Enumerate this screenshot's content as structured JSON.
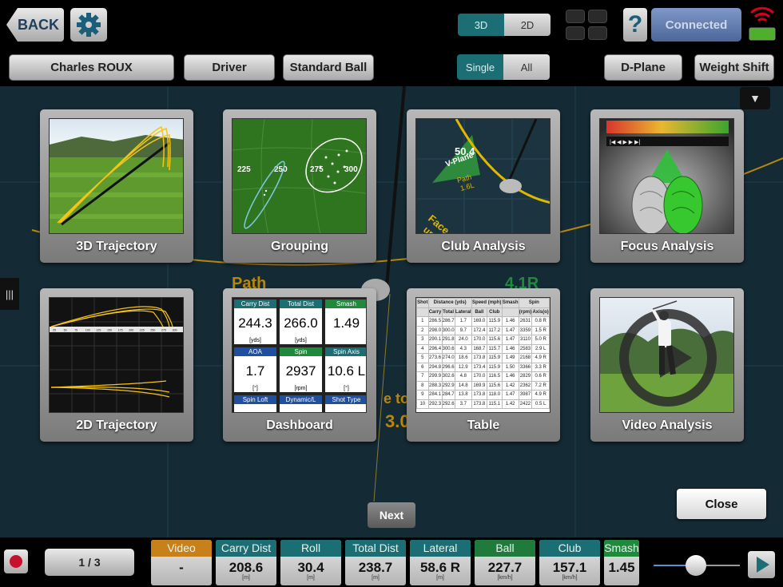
{
  "topbar": {
    "back_label": "BACK",
    "view_modes": [
      "3D",
      "2D"
    ],
    "view_mode_selected": "3D",
    "help_label": "?",
    "connection_label": "Connected"
  },
  "settingsbar": {
    "player_label": "Charles  ROUX",
    "club_label": "Driver",
    "ball_label": "Standard Ball",
    "shot_modes": [
      "Single",
      "All"
    ],
    "shot_mode_selected": "Single",
    "dplane_label": "D-Plane",
    "weight_shift_label": "Weight Shift"
  },
  "background_text": {
    "path_label": "Path",
    "value_label": "4.1R",
    "partial_label": "e to I",
    "partial_value": "3.0F"
  },
  "tiles": [
    {
      "label": "3D Trajectory"
    },
    {
      "label": "Grouping"
    },
    {
      "label": "Club Analysis"
    },
    {
      "label": "Focus Analysis"
    },
    {
      "label": "2D Trajectory"
    },
    {
      "label": "Dashboard"
    },
    {
      "label": "Table"
    },
    {
      "label": "Video Analysis"
    }
  ],
  "grouping_thumb": {
    "ticks": [
      "225",
      "250",
      "275",
      "300"
    ]
  },
  "club_thumb": {
    "value": "50.4",
    "vplane": "V-Plane",
    "path": "Path",
    "path_val": "1.6L",
    "face": "Face",
    "face_val": "up"
  },
  "dashboard_thumb": {
    "cells": [
      {
        "header": "Carry Dist",
        "value": "244.3",
        "unit": "[yds]",
        "color": "#1a6e74"
      },
      {
        "header": "Total Dist",
        "value": "266.0",
        "unit": "[yds]",
        "color": "#1a6e74"
      },
      {
        "header": "Smash",
        "value": "1.49",
        "unit": "",
        "color": "#1f8a3c"
      },
      {
        "header": "AOA",
        "value": "1.7",
        "unit": "[°]",
        "color": "#1f4fa0"
      },
      {
        "header": "Spin",
        "value": "2937",
        "unit": "[rpm]",
        "color": "#1f8a3c"
      },
      {
        "header": "Spin Axis",
        "value": "10.6 L",
        "unit": "[°]",
        "color": "#1a6e74"
      },
      {
        "header": "Spin Loft",
        "value": "",
        "unit": "",
        "color": "#1f4fa0"
      },
      {
        "header": "Dynamic/L",
        "value": "",
        "unit": "",
        "color": "#1f4fa0"
      },
      {
        "header": "Shot Type",
        "value": "",
        "unit": "",
        "color": "#1f4fa0"
      }
    ]
  },
  "table_thumb": {
    "groups": [
      "Distance (yds)",
      "Speed (mph)",
      "Smash",
      "Spin"
    ],
    "shot_header": "Shot",
    "subheaders": [
      "Carry",
      "Total",
      "Lateral",
      "Ball",
      "Club",
      "",
      "(rpm)",
      "Axis(o)"
    ],
    "rows": [
      [
        "1",
        "286.5",
        "286.7",
        "1.7",
        "169.0",
        "115.9",
        "1.46",
        "2631",
        "0.8 R"
      ],
      [
        "2",
        "298.0",
        "300.0",
        "9.7",
        "172.4",
        "117.2",
        "1.47",
        "3359",
        "1.5 R"
      ],
      [
        "3",
        "290.1",
        "291.8",
        "24.0",
        "170.0",
        "115.6",
        "1.47",
        "3110",
        "5.0 R"
      ],
      [
        "4",
        "296.4",
        "300.6",
        "4.3",
        "168.7",
        "115.7",
        "1.46",
        "2583",
        "2.9 L"
      ],
      [
        "5",
        "273.6",
        "274.0",
        "18.6",
        "173.8",
        "115.9",
        "1.49",
        "2168",
        "4.9 R"
      ],
      [
        "6",
        "294.8",
        "296.6",
        "12.9",
        "173.4",
        "115.9",
        "1.50",
        "3366",
        "3.3 R"
      ],
      [
        "7",
        "299.9",
        "302.6",
        "4.8",
        "170.0",
        "116.5",
        "1.46",
        "2829",
        "0.6 R"
      ],
      [
        "8",
        "288.3",
        "292.9",
        "14.8",
        "169.9",
        "115.6",
        "1.42",
        "2362",
        "7.2 R"
      ],
      [
        "9",
        "284.1",
        "284.7",
        "13.8",
        "173.8",
        "118.0",
        "1.47",
        "3987",
        "4.9 R"
      ],
      [
        "10",
        "292.3",
        "292.6",
        "3.7",
        "173.8",
        "115.1",
        "1.42",
        "2422",
        "0.5 L"
      ]
    ]
  },
  "trajectory2d_thumb": {
    "ticks": [
      "25",
      "50",
      "75",
      "100",
      "125",
      "150",
      "175",
      "200",
      "225",
      "250",
      "275",
      "300"
    ]
  },
  "next_label": "Next",
  "close_label": "Close",
  "bottombar": {
    "page_label": "1 / 3",
    "stats": [
      {
        "header": "Video",
        "value": "-",
        "unit": "",
        "color": "#c7801a"
      },
      {
        "header": "Carry Dist",
        "value": "208.6",
        "unit": "[m]",
        "color": "#1a6e74"
      },
      {
        "header": "Roll",
        "value": "30.4",
        "unit": "[m]",
        "color": "#1a6e74"
      },
      {
        "header": "Total Dist",
        "value": "238.7",
        "unit": "[m]",
        "color": "#1a6e74"
      },
      {
        "header": "Lateral",
        "value": "58.6 R",
        "unit": "[m]",
        "color": "#1a6e74"
      },
      {
        "header": "Ball",
        "value": "227.7",
        "unit": "[km/h]",
        "color": "#1f7a3c"
      },
      {
        "header": "Club",
        "value": "157.1",
        "unit": "[km/h]",
        "color": "#1a6e74"
      },
      {
        "header": "Smash",
        "value": "1.45",
        "unit": "",
        "color": "#1f8a3c"
      }
    ],
    "slider_fraction": 0.5
  }
}
